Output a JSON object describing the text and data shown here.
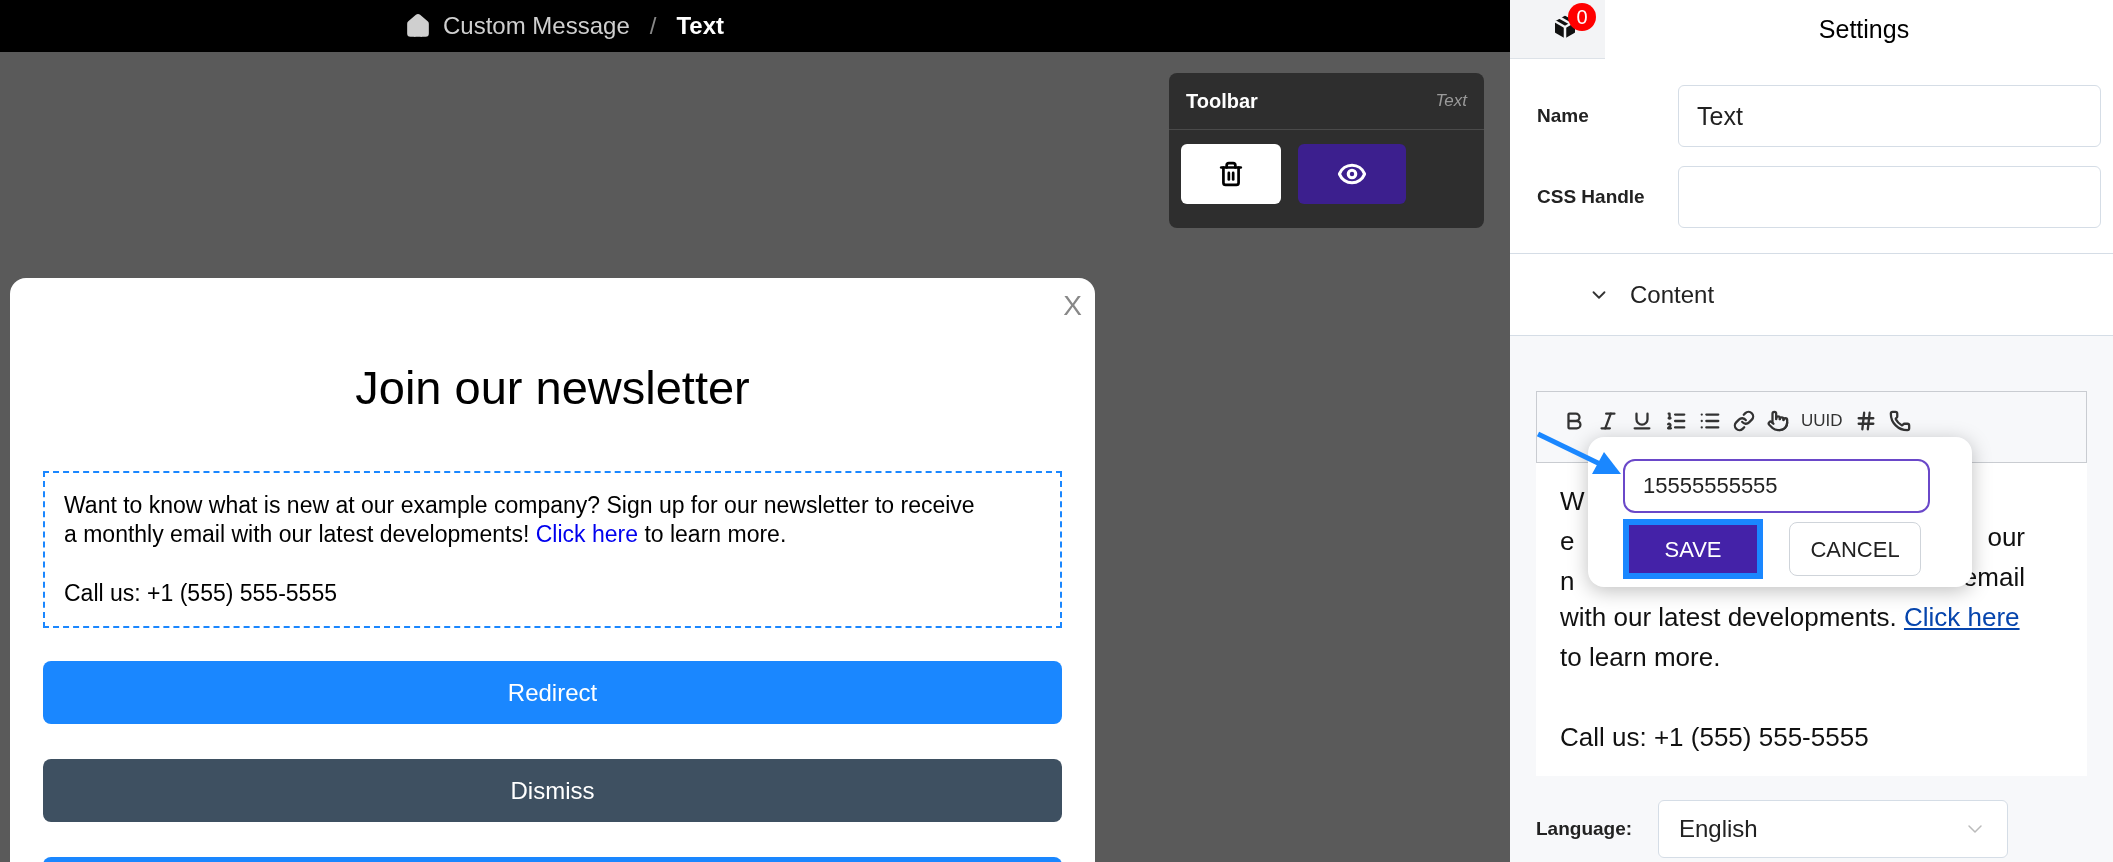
{
  "breadcrumb": {
    "items": [
      {
        "label": "Custom Message",
        "current": false
      },
      {
        "label": "Text",
        "current": true
      }
    ],
    "separator": "/"
  },
  "toolbar": {
    "title": "Toolbar",
    "element_type": "Text"
  },
  "modal": {
    "close": "X",
    "heading": "Join our newsletter",
    "body": {
      "paragraph": "Want to know what is new at our example company? Sign up for our newsletter to receive a monthly email with our latest developments!",
      "link": "Click here",
      "after_link": "to learn more.",
      "call": "Call us: +1 (555) 555-5555"
    },
    "buttons": [
      {
        "label": "Redirect",
        "kind": "primary"
      },
      {
        "label": "Dismiss",
        "kind": "secondary"
      },
      {
        "kind": "primary"
      }
    ]
  },
  "settings": {
    "badge": "0",
    "title": "Settings",
    "fields": [
      {
        "label": "Name",
        "value": "Text"
      },
      {
        "label": "CSS Handle"
      }
    ],
    "section": {
      "label": "Content",
      "expanded": true
    },
    "editor": {
      "tools": [
        {
          "kind": "bold"
        },
        {
          "kind": "italic"
        },
        {
          "kind": "underline"
        },
        {
          "kind": "ordered-list"
        },
        {
          "kind": "list"
        },
        {
          "kind": "link"
        },
        {
          "kind": "pointer"
        },
        {
          "kind": "text",
          "label": "UUID"
        },
        {
          "kind": "hash"
        },
        {
          "kind": "phone"
        }
      ],
      "lines": [
        {
          "kind": "split",
          "left": "W"
        },
        {
          "kind": "split",
          "left": "e",
          "right": "our"
        },
        {
          "kind": "split",
          "left": "n",
          "right": "email"
        },
        {
          "kind": "link",
          "text": "with our latest developments.",
          "link": "Click here"
        },
        {
          "kind": "text",
          "text": "to learn more."
        },
        {
          "kind": "paragraph",
          "text": "Call us: +1 (555) 555-5555"
        }
      ],
      "link_popup": {
        "value": "15555555555",
        "save": "SAVE",
        "cancel": "CANCEL"
      }
    },
    "language": {
      "label": "Language:",
      "value": "English"
    }
  }
}
